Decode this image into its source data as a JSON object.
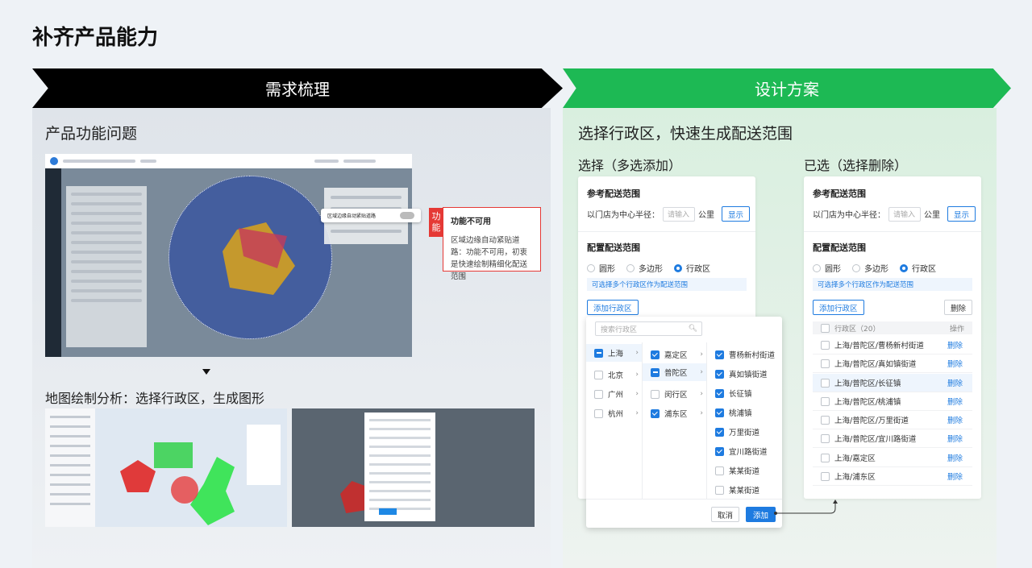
{
  "page_title": "补齐产品能力",
  "banners": {
    "left": "需求梳理",
    "right": "设计方案"
  },
  "left": {
    "section_title": "产品功能问题",
    "toggle_tip": "区域边缘自动紧贴道路",
    "callout": {
      "tag": [
        "功",
        "能"
      ],
      "heading": "功能不可用",
      "text": "区域边缘自动紧贴道路：功能不可用，初衷是快速绘制精细化配送范围"
    },
    "analysis_title": "地图绘制分析：选择行政区，生成图形"
  },
  "right": {
    "section_title": "选择行政区，快速生成配送范围",
    "select_label": "选择（多选添加）",
    "selected_label": "已选（选择删除）",
    "card": {
      "ref_title": "参考配送范围",
      "radius_label": "以门店为中心半径：",
      "radius_placeholder": "请输入",
      "unit": "公里",
      "show_btn": "显示",
      "config_title": "配置配送范围",
      "shapes": [
        "圆形",
        "多边形",
        "行政区"
      ],
      "hint": "可选择多个行政区作为配送范围",
      "add_btn": "添加行政区",
      "delete_btn": "删除"
    },
    "dropdown": {
      "search_placeholder": "搜索行政区",
      "cities": [
        {
          "label": "上海",
          "state": "half"
        },
        {
          "label": "北京",
          "state": "off"
        },
        {
          "label": "广州",
          "state": "off"
        },
        {
          "label": "杭州",
          "state": "off"
        }
      ],
      "districts": [
        {
          "label": "嘉定区",
          "state": "on"
        },
        {
          "label": "普陀区",
          "state": "half"
        },
        {
          "label": "闵行区",
          "state": "off"
        },
        {
          "label": "浦东区",
          "state": "on"
        }
      ],
      "streets": [
        {
          "label": "曹杨新村街道",
          "state": "on"
        },
        {
          "label": "真如镇街道",
          "state": "on"
        },
        {
          "label": "长征镇",
          "state": "on"
        },
        {
          "label": "桃浦镇",
          "state": "on"
        },
        {
          "label": "万里街道",
          "state": "on"
        },
        {
          "label": "宜川路街道",
          "state": "on"
        },
        {
          "label": "某某街道",
          "state": "off"
        },
        {
          "label": "某某街道",
          "state": "off"
        }
      ],
      "cancel_btn": "取消",
      "add_btn": "添加"
    },
    "table": {
      "header": "行政区（20）",
      "op_header": "操作",
      "rows": [
        "上海/普陀区/曹杨新村街道",
        "上海/普陀区/真如镇街道",
        "上海/普陀区/长征镇",
        "上海/普陀区/桃浦镇",
        "上海/普陀区/万里街道",
        "上海/普陀区/宜川路街道",
        "上海/嘉定区",
        "上海/浦东区"
      ],
      "delete_label": "删除"
    }
  },
  "colors": {
    "accent": "#1e7be0",
    "green": "#1db954",
    "red": "#e53935"
  }
}
